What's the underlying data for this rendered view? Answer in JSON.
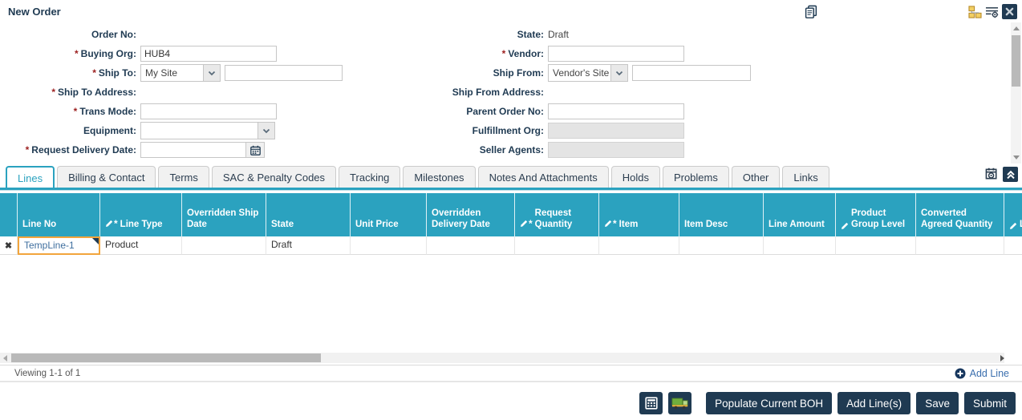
{
  "app": {
    "title": "New Order"
  },
  "form": {
    "left": [
      {
        "label": "Order No",
        "required": false,
        "type": "none"
      },
      {
        "label": "Buying Org",
        "required": true,
        "type": "input",
        "value": "HUB4",
        "width": 170
      },
      {
        "label": "Ship To",
        "required": true,
        "type": "selectinput",
        "select_value": "My Site",
        "select_width": 100,
        "value": "",
        "width": 147
      },
      {
        "label": "Ship To Address",
        "required": true,
        "type": "none"
      },
      {
        "label": "Trans Mode",
        "required": true,
        "type": "input",
        "value": "",
        "width": 170
      },
      {
        "label": "Equipment",
        "required": false,
        "type": "select",
        "select_value": "",
        "select_width": 168
      },
      {
        "label": "Request Delivery Date",
        "required": true,
        "type": "date",
        "value": "",
        "width": 155
      }
    ],
    "right": [
      {
        "label": "State",
        "required": false,
        "type": "static",
        "value": "Draft"
      },
      {
        "label": "Vendor",
        "required": true,
        "type": "input",
        "value": "",
        "width": 170
      },
      {
        "label": "Ship From",
        "required": false,
        "type": "selectinput",
        "select_value": "Vendor's Site",
        "select_width": 100,
        "value": "",
        "width": 148
      },
      {
        "label": "Ship From Address",
        "required": false,
        "type": "none"
      },
      {
        "label": "Parent Order No",
        "required": false,
        "type": "input",
        "value": "",
        "width": 170
      },
      {
        "label": "Fulfillment Org",
        "required": false,
        "type": "disabled",
        "value": "",
        "width": 170
      },
      {
        "label": "Seller Agents",
        "required": false,
        "type": "disabled",
        "value": "",
        "width": 170
      }
    ]
  },
  "tabs": {
    "active": "Lines",
    "items": [
      "Lines",
      "Billing & Contact",
      "Terms",
      "SAC & Penalty Codes",
      "Tracking",
      "Milestones",
      "Notes And Attachments",
      "Holds",
      "Problems",
      "Other",
      "Links"
    ]
  },
  "grid": {
    "columns": [
      {
        "label": "",
        "width": 22
      },
      {
        "label": "Line No",
        "width": 103
      },
      {
        "label": "Line Type",
        "width": 102,
        "editable": true,
        "required": true
      },
      {
        "label": "Overridden Ship Date",
        "width": 105
      },
      {
        "label": "State",
        "width": 105
      },
      {
        "label": "Unit Price",
        "width": 95
      },
      {
        "label": "Overridden Delivery Date",
        "width": 110
      },
      {
        "label": "Request Quantity",
        "width": 105,
        "editable": true,
        "required": true
      },
      {
        "label": "Item",
        "width": 100,
        "editable": true,
        "required": true
      },
      {
        "label": "Item Desc",
        "width": 105
      },
      {
        "label": "Line Amount",
        "width": 90
      },
      {
        "label": "Product Group Level",
        "width": 100,
        "editable": true
      },
      {
        "label": "Converted Agreed Quantity",
        "width": 110
      },
      {
        "label": "Li",
        "width": 60,
        "editable": true
      }
    ],
    "rows": [
      {
        "delete_icon": "✖",
        "selected_cell": 1,
        "cells": [
          "",
          "TempLine-1",
          "Product",
          "",
          "Draft",
          "",
          "",
          "",
          "",
          "",
          "",
          "",
          "",
          ""
        ]
      }
    ]
  },
  "pager": {
    "viewing": "Viewing 1-1 of 1",
    "add_line": "Add Line"
  },
  "actions": {
    "icon_buttons": [
      "calculator-icon",
      "truck-icon"
    ],
    "buttons": [
      {
        "label": "Populate Current BOH"
      },
      {
        "label": "Add Line(s)"
      },
      {
        "label": "Save"
      },
      {
        "label": "Submit"
      }
    ]
  },
  "colors": {
    "teal": "#2ba2bf",
    "navy": "#1f3a52",
    "link_blue": "#3b6fae",
    "required_red": "#9c1f1f",
    "selected_cell_border": "#f2a53c",
    "disabled_bg": "#e4e4e4"
  }
}
